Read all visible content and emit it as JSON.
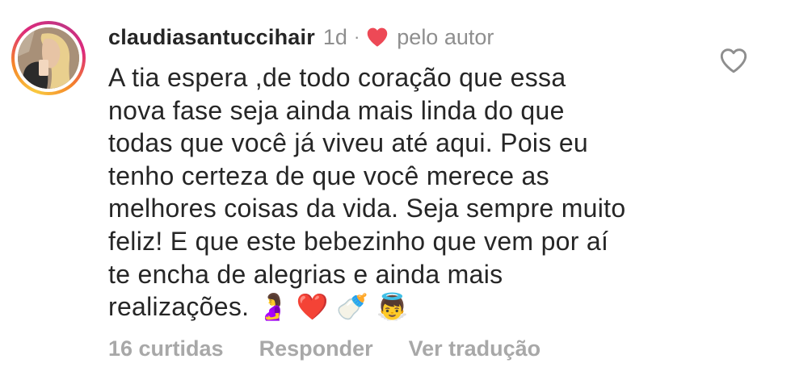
{
  "comment": {
    "username": "claudiasantuccihair",
    "time": "1d",
    "separator": "·",
    "liked_by_author_label": "pelo autor",
    "text_lines": [
      "A tia espera ,de todo coração que essa",
      "nova fase seja ainda mais linda do que",
      "todas que você já viveu até aqui. Pois eu",
      "tenho certeza de que você merece as",
      "melhores coisas da vida. Seja sempre muito",
      "feliz! E que este bebezinho que vem por aí",
      "te encha de alegrias e ainda mais",
      "realizações. 🤰 ❤️ 🍼 👼"
    ],
    "likes_label": "16 curtidas",
    "reply_label": "Responder",
    "translate_label": "Ver tradução"
  },
  "icons": {
    "avatar": "profile-photo",
    "author_heart": "heart-filled-icon",
    "like": "heart-outline-icon"
  },
  "colors": {
    "heart_red": "#ed4956",
    "muted": "#8e8e8e",
    "footer": "#a8a8a8",
    "text": "#262626"
  }
}
